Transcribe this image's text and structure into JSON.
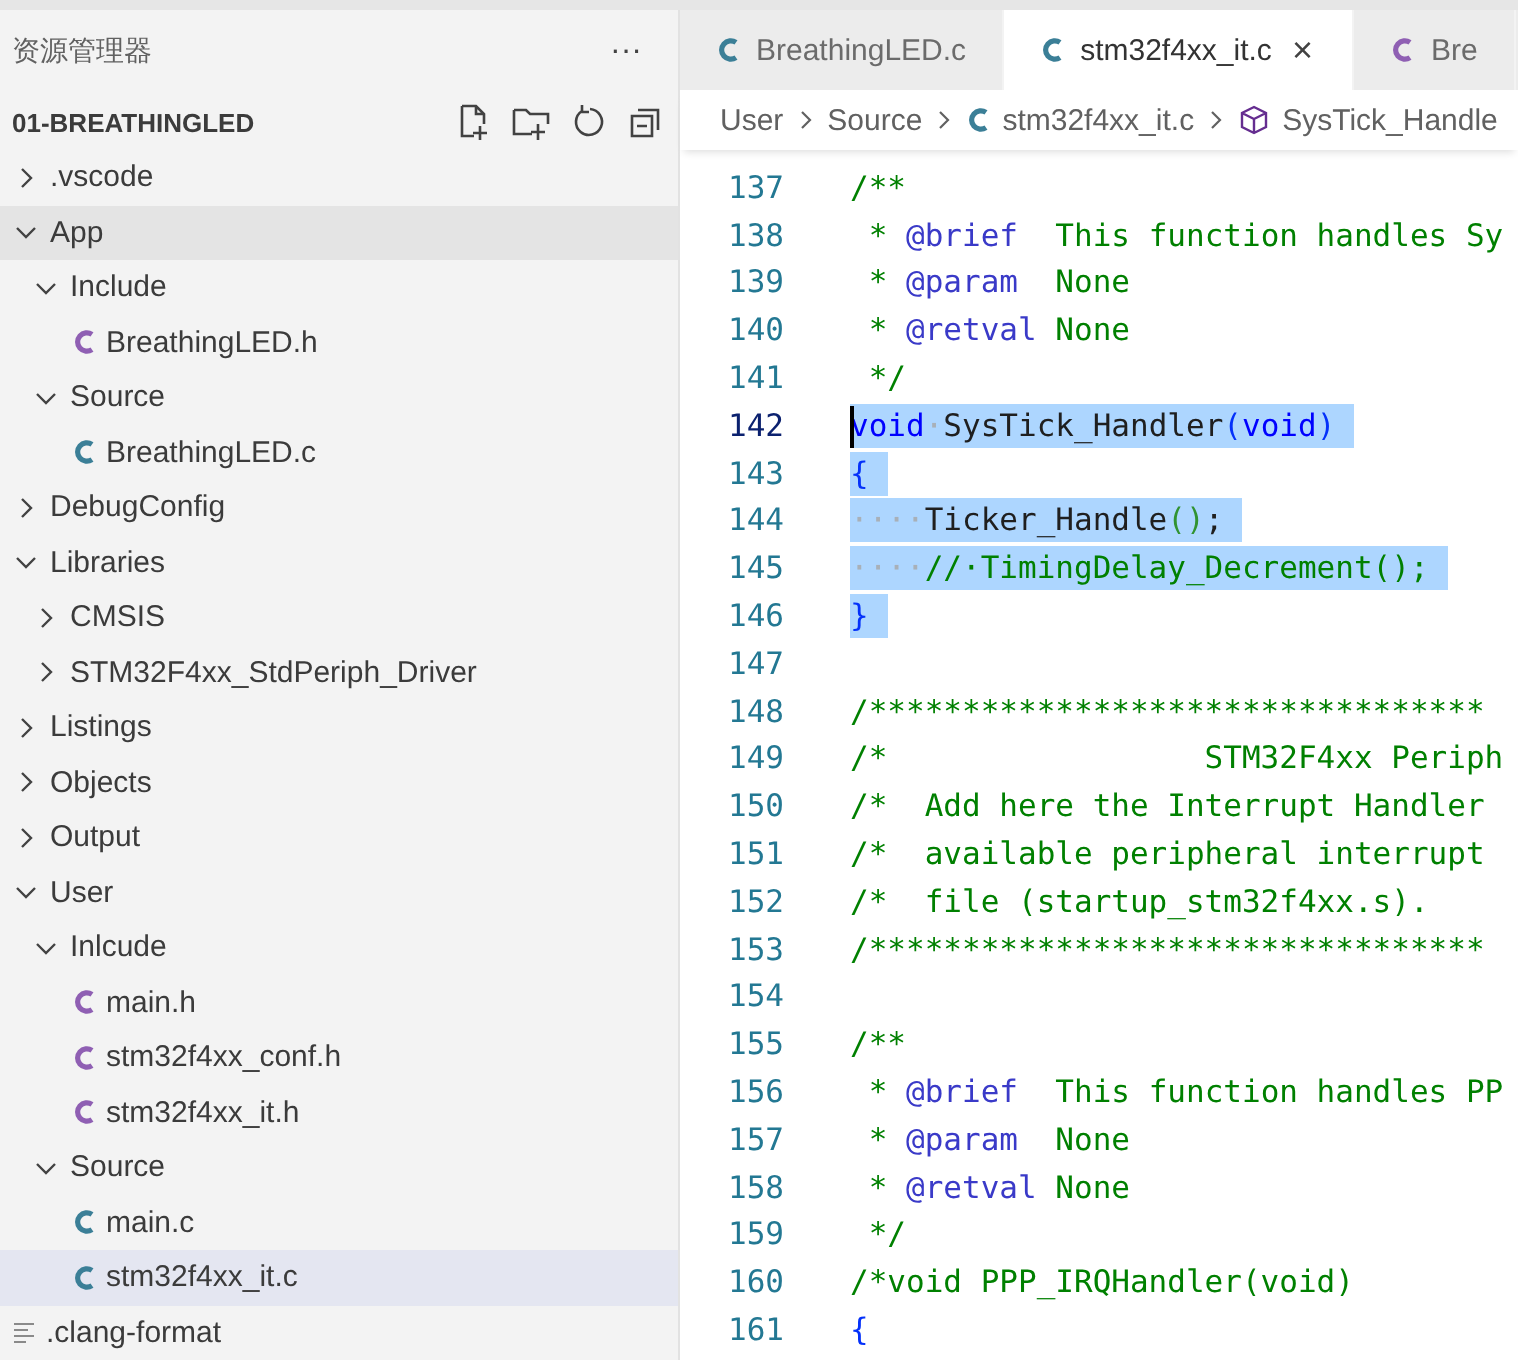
{
  "sidebar": {
    "title": "资源管理器",
    "more": "···",
    "project": "01-BREATHINGLED",
    "tree": [
      {
        "label": ".vscode",
        "kind": "folder",
        "expanded": false,
        "selected": false,
        "hovered": false
      },
      {
        "label": "App",
        "kind": "folder",
        "expanded": true,
        "selected": false,
        "hovered": true,
        "children": [
          {
            "label": "Include",
            "kind": "folder",
            "expanded": true,
            "selected": false,
            "hovered": false,
            "children": [
              {
                "label": "BreathingLED.h",
                "kind": "c_header",
                "selected": false,
                "hovered": false
              }
            ]
          },
          {
            "label": "Source",
            "kind": "folder",
            "expanded": true,
            "selected": false,
            "hovered": false,
            "children": [
              {
                "label": "BreathingLED.c",
                "kind": "c_source",
                "selected": false,
                "hovered": false
              }
            ]
          }
        ]
      },
      {
        "label": "DebugConfig",
        "kind": "folder",
        "expanded": false,
        "selected": false,
        "hovered": false
      },
      {
        "label": "Libraries",
        "kind": "folder",
        "expanded": true,
        "selected": false,
        "hovered": false,
        "children": [
          {
            "label": "CMSIS",
            "kind": "folder",
            "expanded": false,
            "selected": false,
            "hovered": false
          },
          {
            "label": "STM32F4xx_StdPeriph_Driver",
            "kind": "folder",
            "expanded": false,
            "selected": false,
            "hovered": false
          }
        ]
      },
      {
        "label": "Listings",
        "kind": "folder",
        "expanded": false,
        "selected": false,
        "hovered": false
      },
      {
        "label": "Objects",
        "kind": "folder",
        "expanded": false,
        "selected": false,
        "hovered": false
      },
      {
        "label": "Output",
        "kind": "folder",
        "expanded": false,
        "selected": false,
        "hovered": false
      },
      {
        "label": "User",
        "kind": "folder",
        "expanded": true,
        "selected": false,
        "hovered": false,
        "children": [
          {
            "label": "Inlcude",
            "kind": "folder",
            "expanded": true,
            "selected": false,
            "hovered": false,
            "children": [
              {
                "label": "main.h",
                "kind": "c_header",
                "selected": false,
                "hovered": false
              },
              {
                "label": "stm32f4xx_conf.h",
                "kind": "c_header",
                "selected": false,
                "hovered": false
              },
              {
                "label": "stm32f4xx_it.h",
                "kind": "c_header",
                "selected": false,
                "hovered": false
              }
            ]
          },
          {
            "label": "Source",
            "kind": "folder",
            "expanded": true,
            "selected": false,
            "hovered": false,
            "children": [
              {
                "label": "main.c",
                "kind": "c_source",
                "selected": false,
                "hovered": false
              },
              {
                "label": "stm32f4xx_it.c",
                "kind": "c_source",
                "selected": true,
                "hovered": false
              }
            ]
          }
        ]
      },
      {
        "label": ".clang-format",
        "kind": "text",
        "selected": false,
        "hovered": false
      }
    ]
  },
  "tabs": [
    {
      "label": "BreathingLED.c",
      "kind": "c_source",
      "selected": false
    },
    {
      "label": "stm32f4xx_it.c",
      "kind": "c_source",
      "selected": true,
      "close": "×"
    },
    {
      "label": "Bre",
      "kind": "c_header",
      "selected": false
    }
  ],
  "breadcrumb": [
    {
      "label": "User",
      "kind": "folder"
    },
    {
      "label": "Source",
      "kind": "folder"
    },
    {
      "label": "stm32f4xx_it.c",
      "kind": "c_source"
    },
    {
      "label": "SysTick_Handle",
      "kind": "symbol"
    }
  ],
  "code": [
    {
      "number": "137",
      "selected": false,
      "cursor": false,
      "tokens": [
        {
          "text": "/**",
          "kind": "comment"
        }
      ]
    },
    {
      "number": "138",
      "selected": false,
      "cursor": false,
      "tokens": [
        {
          "text": " * ",
          "kind": "comment"
        },
        {
          "text": "@brief",
          "kind": "doctag"
        },
        {
          "text": "  This function handles Sy",
          "kind": "comment"
        }
      ]
    },
    {
      "number": "139",
      "selected": false,
      "cursor": false,
      "tokens": [
        {
          "text": " * ",
          "kind": "comment"
        },
        {
          "text": "@param",
          "kind": "doctag"
        },
        {
          "text": "  None",
          "kind": "comment"
        }
      ]
    },
    {
      "number": "140",
      "selected": false,
      "cursor": false,
      "tokens": [
        {
          "text": " * ",
          "kind": "comment"
        },
        {
          "text": "@retval",
          "kind": "doctag"
        },
        {
          "text": " None",
          "kind": "comment"
        }
      ]
    },
    {
      "number": "141",
      "selected": false,
      "cursor": false,
      "tokens": [
        {
          "text": " */",
          "kind": "comment"
        }
      ]
    },
    {
      "number": "142",
      "selected": true,
      "cursor": true,
      "tokens": [
        {
          "text": "void",
          "kind": "keyword"
        },
        {
          "text": "·",
          "kind": "whitespace"
        },
        {
          "text": "SysTick_Handler",
          "kind": "plain"
        },
        {
          "text": "(",
          "kind": "bracket"
        },
        {
          "text": "void",
          "kind": "keyword"
        },
        {
          "text": ")",
          "kind": "bracket"
        }
      ]
    },
    {
      "number": "143",
      "selected": true,
      "cursor": false,
      "tokens": [
        {
          "text": "{",
          "kind": "bracket"
        }
      ]
    },
    {
      "number": "144",
      "selected": true,
      "cursor": false,
      "tokens": [
        {
          "text": "····",
          "kind": "whitespace"
        },
        {
          "text": "Ticker_Handle",
          "kind": "plain"
        },
        {
          "text": "()",
          "kind": "bracket2"
        },
        {
          "text": ";",
          "kind": "plain"
        }
      ]
    },
    {
      "number": "145",
      "selected": true,
      "cursor": false,
      "tokens": [
        {
          "text": "····",
          "kind": "whitespace"
        },
        {
          "text": "//·TimingDelay_Decrement();",
          "kind": "comment"
        }
      ]
    },
    {
      "number": "146",
      "selected": true,
      "cursor": false,
      "tokens": [
        {
          "text": "}",
          "kind": "bracket"
        }
      ]
    },
    {
      "number": "147",
      "selected": false,
      "cursor": false
    },
    {
      "number": "148",
      "selected": false,
      "cursor": false,
      "tokens": [
        {
          "text": "/*********************************",
          "kind": "comment"
        }
      ]
    },
    {
      "number": "149",
      "selected": false,
      "cursor": false,
      "tokens": [
        {
          "text": "/*                 STM32F4xx Periph",
          "kind": "comment"
        }
      ]
    },
    {
      "number": "150",
      "selected": false,
      "cursor": false,
      "tokens": [
        {
          "text": "/*  Add here the Interrupt Handler",
          "kind": "comment"
        }
      ]
    },
    {
      "number": "151",
      "selected": false,
      "cursor": false,
      "tokens": [
        {
          "text": "/*  available peripheral interrupt",
          "kind": "comment"
        }
      ]
    },
    {
      "number": "152",
      "selected": false,
      "cursor": false,
      "tokens": [
        {
          "text": "/*  file (startup_stm32f4xx.s).",
          "kind": "comment"
        }
      ]
    },
    {
      "number": "153",
      "selected": false,
      "cursor": false,
      "tokens": [
        {
          "text": "/*********************************",
          "kind": "comment"
        }
      ]
    },
    {
      "number": "154",
      "selected": false,
      "cursor": false
    },
    {
      "number": "155",
      "selected": false,
      "cursor": false,
      "tokens": [
        {
          "text": "/**",
          "kind": "comment"
        }
      ]
    },
    {
      "number": "156",
      "selected": false,
      "cursor": false,
      "tokens": [
        {
          "text": " * ",
          "kind": "comment"
        },
        {
          "text": "@brief",
          "kind": "doctag"
        },
        {
          "text": "  This function handles PP",
          "kind": "comment"
        }
      ]
    },
    {
      "number": "157",
      "selected": false,
      "cursor": false,
      "tokens": [
        {
          "text": " * ",
          "kind": "comment"
        },
        {
          "text": "@param",
          "kind": "doctag"
        },
        {
          "text": "  None",
          "kind": "comment"
        }
      ]
    },
    {
      "number": "158",
      "selected": false,
      "cursor": false,
      "tokens": [
        {
          "text": " * ",
          "kind": "comment"
        },
        {
          "text": "@retval",
          "kind": "doctag"
        },
        {
          "text": " None",
          "kind": "comment"
        }
      ]
    },
    {
      "number": "159",
      "selected": false,
      "cursor": false,
      "tokens": [
        {
          "text": " */",
          "kind": "comment"
        }
      ]
    },
    {
      "number": "160",
      "selected": false,
      "cursor": false,
      "tokens": [
        {
          "text": "/*void PPP_IRQHandler(void)",
          "kind": "comment"
        }
      ]
    },
    {
      "number": "161",
      "selected": false,
      "cursor": false,
      "tokens": [
        {
          "text": "{",
          "kind": "bracket"
        }
      ]
    }
  ]
}
